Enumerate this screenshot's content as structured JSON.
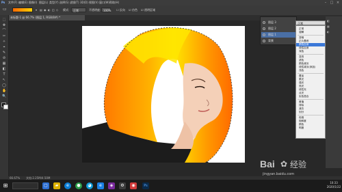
{
  "menu": {
    "items": [
      "文件(F)",
      "编辑(E)",
      "图像(I)",
      "图层(L)",
      "类型(Y)",
      "选择(S)",
      "滤镜(T)",
      "3D(D)",
      "视图(V)",
      "窗口(W)",
      "帮助(H)"
    ],
    "window_buttons": [
      "–",
      "□",
      "×"
    ]
  },
  "options": {
    "mode_label": "模式:",
    "mode_value": "正常",
    "opacity_label": "不透明度:",
    "opacity_value": "100%",
    "reverse_label": "反向",
    "dither_label": "仿色",
    "transparency_label": "透明区域"
  },
  "document": {
    "tab_title": "未标题-1 @ 66.7% (图层 1, RGB/8#) *"
  },
  "tools": [
    "⬚",
    "✥",
    "⌒",
    "✂",
    "✧",
    "⌖",
    "✎",
    "⊘",
    "▦",
    "◧",
    "T",
    "↖",
    "◯",
    "✋",
    "🔍"
  ],
  "layers_panel": {
    "rows": [
      {
        "name": "图层 3"
      },
      {
        "name": "图层 2"
      },
      {
        "name": "图层 1"
      },
      {
        "name": "背景"
      }
    ]
  },
  "blend": {
    "selected": "正常",
    "groups": [
      [
        "正常",
        "溶解"
      ],
      [
        "变暗",
        "正片叠底",
        "颜色加深",
        "线性加深",
        "深色"
      ],
      [
        "变亮",
        "滤色",
        "颜色减淡",
        "线性减淡(添加)",
        "浅色"
      ],
      [
        "叠加",
        "柔光",
        "强光",
        "亮光",
        "线性光",
        "点光",
        "实色混合"
      ],
      [
        "差值",
        "排除",
        "减去",
        "划分"
      ],
      [
        "色相",
        "饱和度",
        "颜色",
        "明度"
      ]
    ],
    "highlighted": "颜色加深"
  },
  "statusbar": {
    "zoom": "66.67%",
    "doc_info": "文档:2.25M/4.50M"
  },
  "taskbar": {
    "search_placeholder": "",
    "clock_time": "10:33",
    "clock_date": "2020/1/22"
  },
  "watermark": {
    "brand": "Bai",
    "brand2": "经验",
    "url": "jingyan.baidu.com"
  },
  "colors": {
    "accent": "#3b78d8",
    "hair_orange": "#ff7a00",
    "hair_yellow": "#ffe000"
  }
}
